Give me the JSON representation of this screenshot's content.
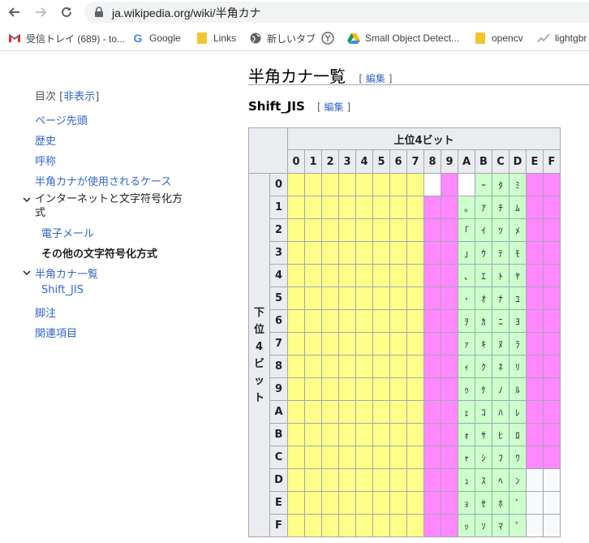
{
  "browser": {
    "url": "ja.wikipedia.org/wiki/半角カナ",
    "bookmarks": [
      {
        "label": "受信トレイ (689) - to...",
        "icon": "gmail-icon"
      },
      {
        "label": "Google",
        "icon": "google-icon"
      },
      {
        "label": "Links",
        "icon": "folder-icon"
      },
      {
        "label": "新しいタブ",
        "icon": "globe-icon"
      },
      {
        "label": "",
        "icon": "y-icon"
      },
      {
        "label": "Small Object Detect...",
        "icon": "drive-icon"
      },
      {
        "label": "opencv",
        "icon": "folder-icon"
      },
      {
        "label": "lightgbr",
        "icon": "chart-icon"
      }
    ]
  },
  "toc": {
    "title": "目次",
    "hide_label": "非表示",
    "items": [
      {
        "label": "ページ先頭",
        "indent": 0,
        "bold": false,
        "chevron": false
      },
      {
        "label": "歴史",
        "indent": 0,
        "bold": false,
        "chevron": false
      },
      {
        "label": "呼称",
        "indent": 0,
        "bold": false,
        "chevron": false
      },
      {
        "label": "半角カナが使用されるケース",
        "indent": 0,
        "bold": false,
        "chevron": false
      },
      {
        "label": "インターネットと文字符号化方",
        "label2": "式",
        "indent": 0,
        "bold": false,
        "chevron": true,
        "dark": true
      },
      {
        "label": "電子メール",
        "indent": 1,
        "bold": false,
        "chevron": false
      },
      {
        "label": "その他の文字符号化方式",
        "indent": 1,
        "bold": true,
        "chevron": false
      },
      {
        "label": "半角カナ一覧",
        "indent": 0,
        "bold": false,
        "chevron": true
      },
      {
        "label": "Shift_JIS",
        "indent": 1,
        "bold": false,
        "chevron": false
      },
      {
        "label": "脚注",
        "indent": 0,
        "bold": false,
        "chevron": false
      },
      {
        "label": "関連項目",
        "indent": 0,
        "bold": false,
        "chevron": false
      }
    ]
  },
  "content": {
    "heading": "半角カナ一覧",
    "edit_label": "編集",
    "subheading": "Shift_JIS",
    "sub_edit_label": "編集"
  },
  "table": {
    "upper_header": "上位4ビット",
    "lower_header": "下位4ビット",
    "cols": [
      "0",
      "1",
      "2",
      "3",
      "4",
      "5",
      "6",
      "7",
      "8",
      "9",
      "A",
      "B",
      "C",
      "D",
      "E",
      "F"
    ],
    "rows": [
      "0",
      "1",
      "2",
      "3",
      "4",
      "5",
      "6",
      "7",
      "8",
      "9",
      "A",
      "B",
      "C",
      "D",
      "E",
      "F"
    ],
    "kana_A": [
      "",
      "｡",
      "｢",
      "｣",
      "､",
      "･",
      "ｦ",
      "ｧ",
      "ｨ",
      "ｩ",
      "ｪ",
      "ｫ",
      "ｬ",
      "ｭ",
      "ｮ",
      "ｯ"
    ],
    "kana_B": [
      "ｰ",
      "ｱ",
      "ｲ",
      "ｳ",
      "ｴ",
      "ｵ",
      "ｶ",
      "ｷ",
      "ｸ",
      "ｹ",
      "ｺ",
      "ｻ",
      "ｼ",
      "ｽ",
      "ｾ",
      "ｿ"
    ],
    "kana_C": [
      "ﾀ",
      "ﾁ",
      "ﾂ",
      "ﾃ",
      "ﾄ",
      "ﾅ",
      "ﾆ",
      "ﾇ",
      "ﾈ",
      "ﾉ",
      "ﾊ",
      "ﾋ",
      "ﾌ",
      "ﾍ",
      "ﾎ",
      "ﾏ"
    ],
    "kana_D": [
      "ﾐ",
      "ﾑ",
      "ﾒ",
      "ﾓ",
      "ﾔ",
      "ﾕ",
      "ﾖ",
      "ﾗ",
      "ﾘ",
      "ﾙ",
      "ﾚ",
      "ﾛ",
      "ﾜ",
      "ﾝ",
      "ﾞ",
      "ﾟ"
    ],
    "colors": {
      "single_byte": "#ffff88",
      "lead_byte": "#ff88ff",
      "kana": "#ccffcc",
      "unused": "#f8f9fa"
    }
  }
}
